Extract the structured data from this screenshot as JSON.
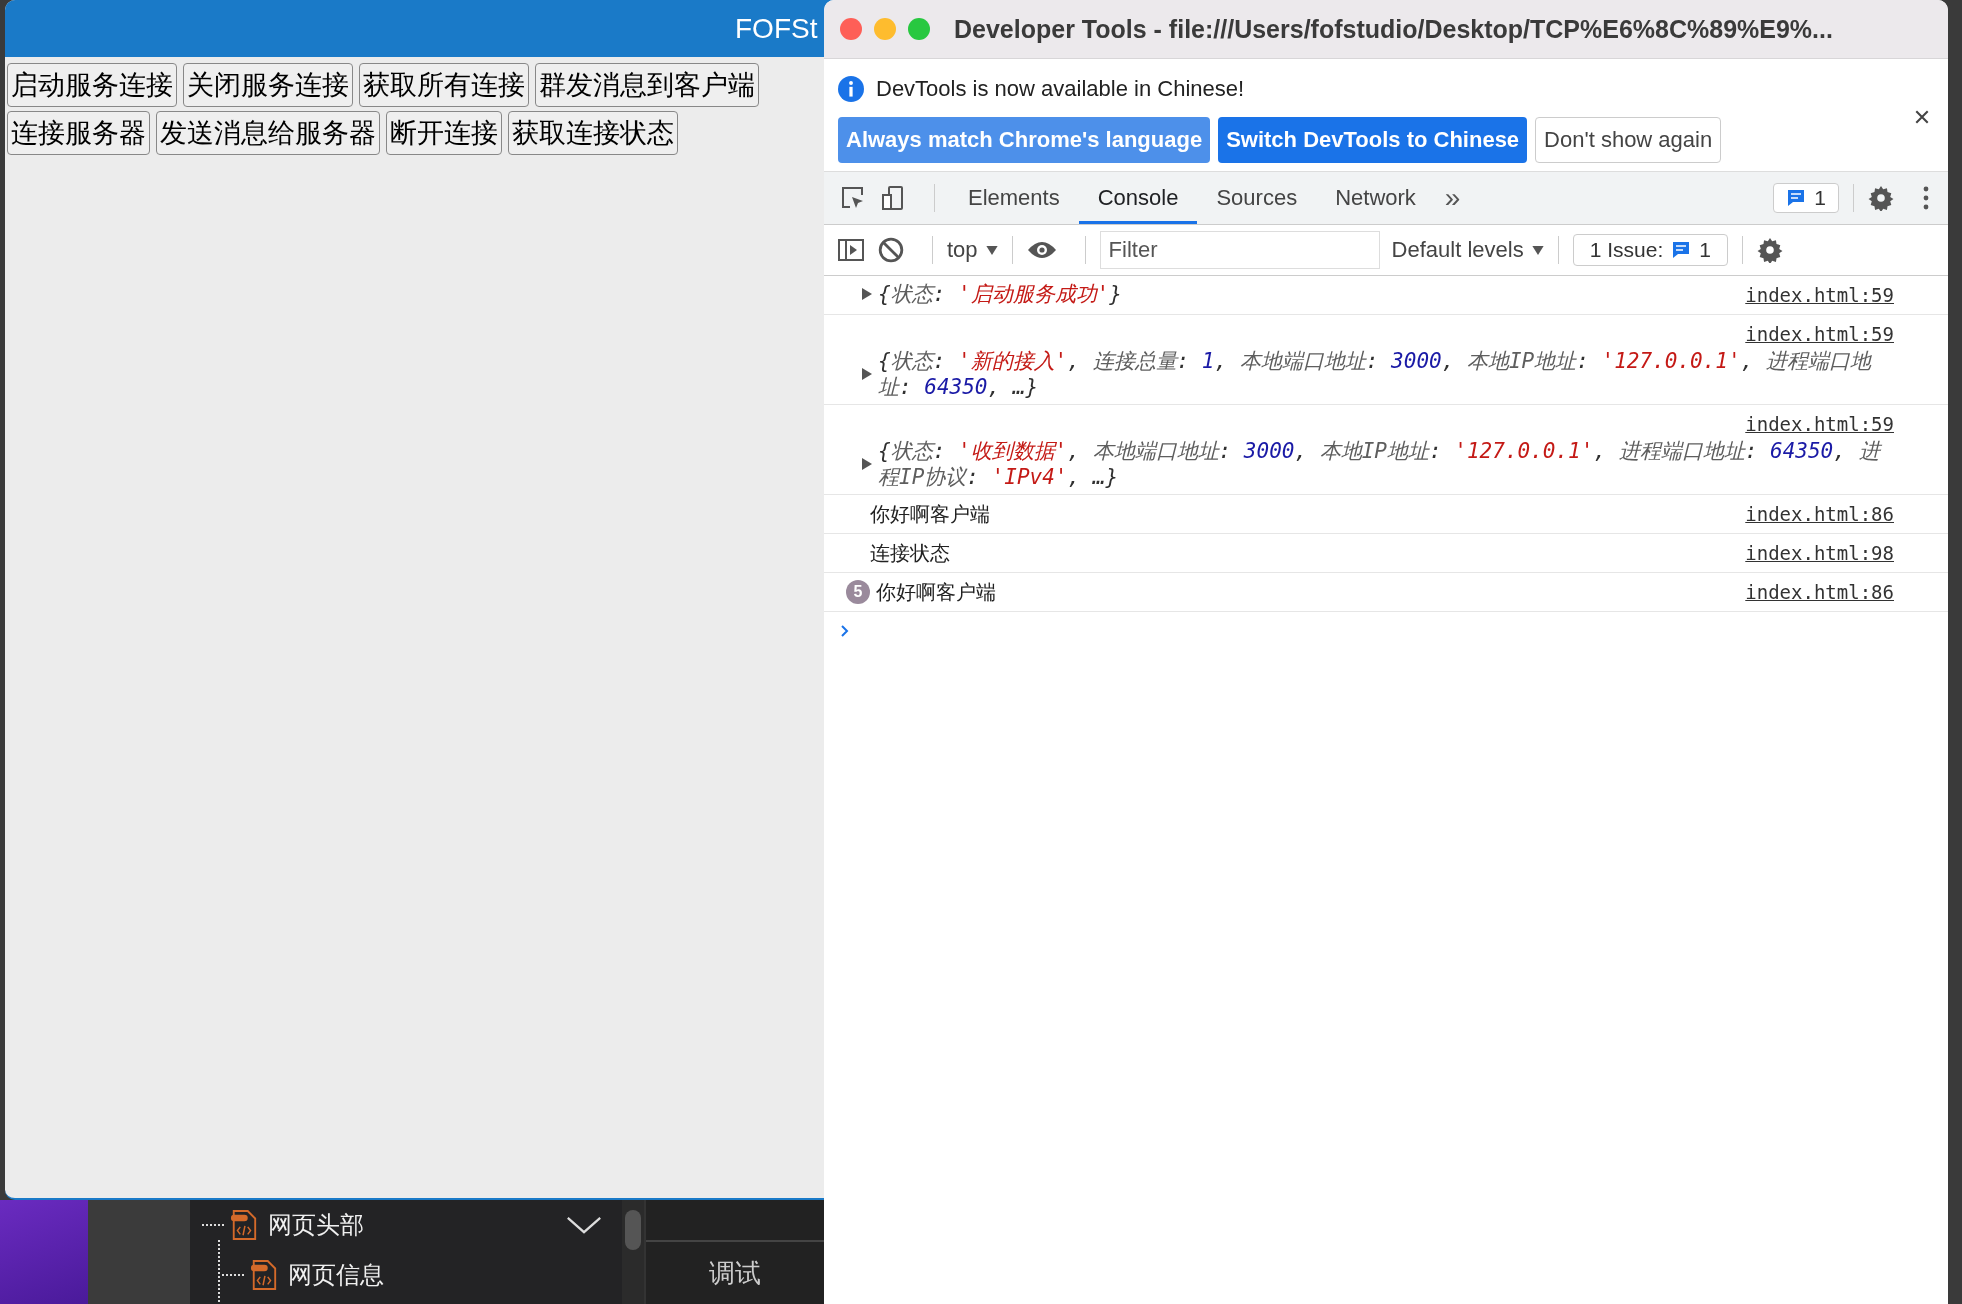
{
  "app_window": {
    "title": "FOFSt",
    "button_rows": [
      [
        "启动服务连接",
        "关闭服务连接",
        "获取所有连接",
        "群发消息到客户端"
      ],
      [
        "连接服务器",
        "发送消息给服务器",
        "断开连接",
        "获取连接状态"
      ]
    ]
  },
  "ide_behind": {
    "tree": [
      {
        "label": "网页头部",
        "expanded": true,
        "children": [
          {
            "label": "网页信息"
          }
        ]
      }
    ],
    "side_tab": "调试"
  },
  "devtools": {
    "title": "Developer Tools - file:///Users/fofstudio/Desktop/TCP%E6%8C%89%E9%...",
    "notice": {
      "message": "DevTools is now available in Chinese!",
      "buttons": [
        {
          "label": "Always match Chrome's language",
          "kind": "secondary"
        },
        {
          "label": "Switch DevTools to Chinese",
          "kind": "primary"
        },
        {
          "label": "Don't show again",
          "kind": "plain"
        }
      ]
    },
    "tabs": [
      {
        "label": "Elements",
        "selected": false
      },
      {
        "label": "Console",
        "selected": true
      },
      {
        "label": "Sources",
        "selected": false
      },
      {
        "label": "Network",
        "selected": false
      }
    ],
    "more_tabs": "»",
    "messages_count": "1",
    "context": "top",
    "filter": {
      "placeholder": "Filter"
    },
    "levels": "Default levels",
    "issues": {
      "label": "1 Issue:",
      "count": "1"
    },
    "console": [
      {
        "kind": "object",
        "source": "index.html:59",
        "parts": [
          {
            "kind": "punct",
            "s": "{"
          },
          {
            "kind": "key",
            "s": "状态"
          },
          {
            "kind": "punct",
            "s": ": "
          },
          {
            "kind": "string",
            "s": "'启动服务成功'"
          },
          {
            "kind": "punct",
            "s": "}"
          }
        ]
      },
      {
        "kind": "object",
        "source": "index.html:59",
        "parts": [
          {
            "kind": "punct",
            "s": "{"
          },
          {
            "kind": "key",
            "s": "状态"
          },
          {
            "kind": "punct",
            "s": ": "
          },
          {
            "kind": "string",
            "s": "'新的接入'"
          },
          {
            "kind": "punct",
            "s": ", "
          },
          {
            "kind": "key",
            "s": "连接总量"
          },
          {
            "kind": "punct",
            "s": ": "
          },
          {
            "kind": "number",
            "s": "1"
          },
          {
            "kind": "punct",
            "s": ", "
          },
          {
            "kind": "key",
            "s": "本地端口地址"
          },
          {
            "kind": "punct",
            "s": ": "
          },
          {
            "kind": "number",
            "s": "3000"
          },
          {
            "kind": "punct",
            "s": ", "
          },
          {
            "kind": "key",
            "s": "本地IP地址"
          },
          {
            "kind": "punct",
            "s": ": "
          },
          {
            "kind": "string",
            "s": "'127.0.0.1'"
          },
          {
            "kind": "punct",
            "s": ", "
          },
          {
            "kind": "key",
            "s": "进程端口地址"
          },
          {
            "kind": "punct",
            "s": ": "
          },
          {
            "kind": "number",
            "s": "64350"
          },
          {
            "kind": "punct",
            "s": ", …}"
          }
        ]
      },
      {
        "kind": "object",
        "source": "index.html:59",
        "parts": [
          {
            "kind": "punct",
            "s": "{"
          },
          {
            "kind": "key",
            "s": "状态"
          },
          {
            "kind": "punct",
            "s": ": "
          },
          {
            "kind": "string",
            "s": "'收到数据'"
          },
          {
            "kind": "punct",
            "s": ", "
          },
          {
            "kind": "key",
            "s": "本地端口地址"
          },
          {
            "kind": "punct",
            "s": ": "
          },
          {
            "kind": "number",
            "s": "3000"
          },
          {
            "kind": "punct",
            "s": ", "
          },
          {
            "kind": "key",
            "s": "本地IP地址"
          },
          {
            "kind": "punct",
            "s": ": "
          },
          {
            "kind": "string",
            "s": "'127.0.0.1'"
          },
          {
            "kind": "punct",
            "s": ", "
          },
          {
            "kind": "key",
            "s": "进程端口地址"
          },
          {
            "kind": "punct",
            "s": ": "
          },
          {
            "kind": "number",
            "s": "64350"
          },
          {
            "kind": "punct",
            "s": ", "
          },
          {
            "kind": "key",
            "s": "进程IP协议"
          },
          {
            "kind": "punct",
            "s": ": "
          },
          {
            "kind": "string",
            "s": "'IPv4'"
          },
          {
            "kind": "punct",
            "s": ", …}"
          }
        ]
      },
      {
        "kind": "log",
        "text": "你好啊客户端",
        "source": "index.html:86"
      },
      {
        "kind": "log",
        "text": "连接状态",
        "source": "index.html:98"
      },
      {
        "kind": "log",
        "text": "你好啊客户端",
        "repeat": "5",
        "source": "index.html:86"
      }
    ]
  }
}
